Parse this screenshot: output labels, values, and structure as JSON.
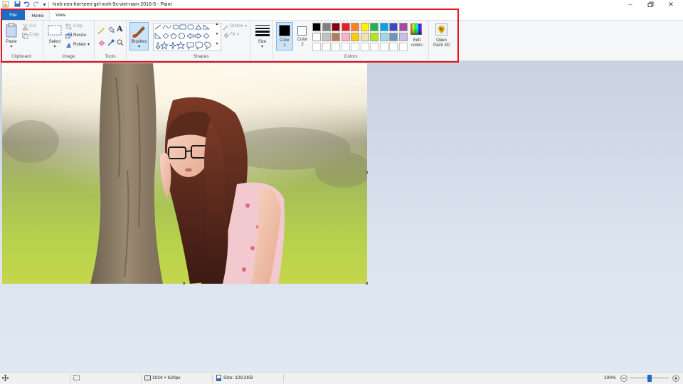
{
  "titlebar": {
    "title": "hinh-nen-hot-teen-girl-xinh-9x-viet-nam-2016-5 - Paint",
    "quick_access": [
      "paint-app-icon",
      "save-icon",
      "undo-icon",
      "redo-icon",
      "customize-dropdown-icon"
    ],
    "window_controls": [
      "minimize",
      "restore",
      "close"
    ]
  },
  "tabs": {
    "file": "File",
    "home": "Home",
    "view": "View"
  },
  "ribbon": {
    "clipboard": {
      "label": "Clipboard",
      "paste": "Paste",
      "cut": "Cut",
      "copy": "Copy"
    },
    "image": {
      "label": "Image",
      "select": "Select",
      "crop": "Crop",
      "resize": "Resize",
      "rotate": "Rotate"
    },
    "tools": {
      "label": "Tools"
    },
    "brushes": {
      "label": "Brushes"
    },
    "shapes": {
      "label": "Shapes",
      "outline": "Outline",
      "fill": "Fill"
    },
    "size": {
      "label": "Size"
    },
    "colors": {
      "label": "Colors",
      "color1": "Color",
      "color1_num": "1",
      "color2": "Color",
      "color2_num": "2",
      "color1_value": "#000000",
      "color2_value": "#ffffff",
      "edit_colors_1": "Edit",
      "edit_colors_2": "colors",
      "palette_row1": [
        "#000000",
        "#7f7f7f",
        "#880015",
        "#ed1c24",
        "#ff7f27",
        "#fff200",
        "#22b14c",
        "#00a2e8",
        "#3f48cc",
        "#a349a4"
      ],
      "palette_row2": [
        "#ffffff",
        "#c3c3c3",
        "#b97a57",
        "#ffaec9",
        "#ffc90e",
        "#efe4b0",
        "#b5e61d",
        "#99d9ea",
        "#7092be",
        "#c8bfe7"
      ],
      "palette_row3_count": 10
    },
    "paint3d": {
      "line1": "Open",
      "line2": "Paint 3D"
    }
  },
  "statusbar": {
    "dimensions": "1024 × 620px",
    "size": "Size: 129.2KB",
    "zoom": "100%",
    "zoom_minus": "−",
    "zoom_plus": "+",
    "zoom_level": 0.5
  },
  "colors": {
    "accent": "#1e6bc1",
    "highlight_box": "#e3141b"
  }
}
